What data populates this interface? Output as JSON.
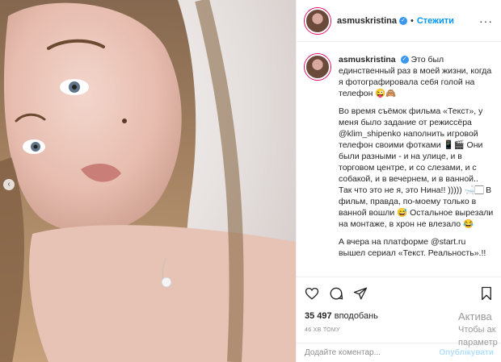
{
  "post": {
    "username": "asmuskristina",
    "follow_label": "Стежити",
    "dot": "•",
    "more": "···",
    "caption": [
      "Это был единственный раз в моей жизни, когда я фотографировала себя голой на телефон 😜🙈",
      "Во время съёмок фильма «Текст», у меня было задание от режиссёра @klim_shipenko наполнить игровой телефон своими фотками 📱🎬 Они были разными - и на улице, и в торговом центре, и со слезами, и с собакой, и в вечернем, и в ванной.. Так что это не я, это Нина!! ))))) 🛁🏻 В фильм, правда, по-моему только в ванной вошли 😅 Остальное вырезали на монтаже, в хрон не влезало 😂",
      "А вчера на платформе @start.ru вышел сериал «Текст. Реальность».!!"
    ],
    "likes_count": "35 497",
    "likes_label": "вподобань",
    "time": "46 ХВ ТОМУ",
    "comment_placeholder": "Додайте коментар...",
    "publish_label": "Опублікувати"
  },
  "watermark": {
    "line1": "Актива",
    "line2": "Чтобы ак",
    "line3": "параметр"
  },
  "icons": [
    "heart-icon",
    "comment-icon",
    "share-icon",
    "bookmark-icon",
    "verified-icon",
    "more-icon"
  ]
}
